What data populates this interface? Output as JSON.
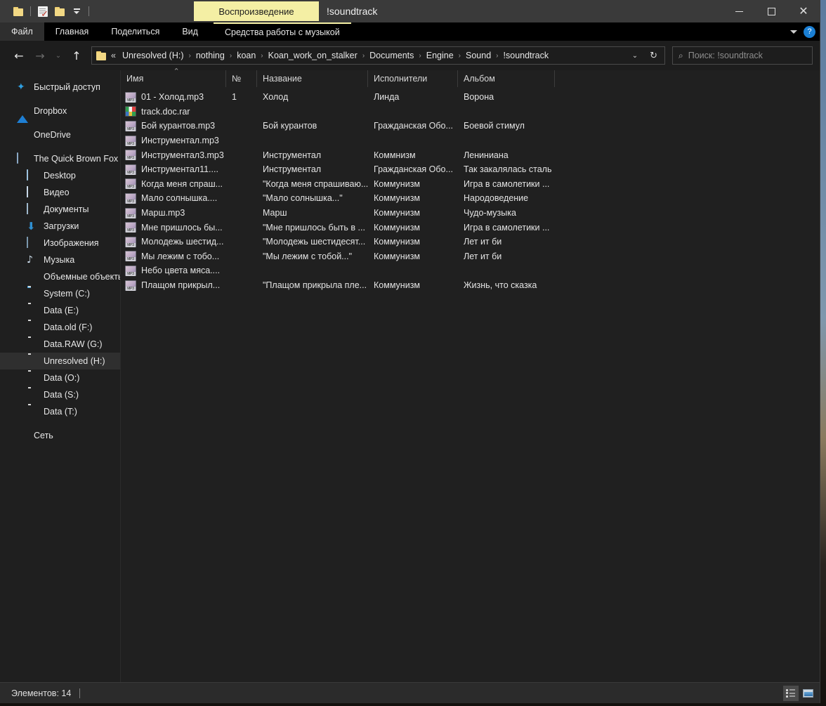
{
  "titlebar": {
    "quick_access": [
      {
        "name": "new-folder-icon",
        "label": "Новая папка"
      },
      {
        "name": "properties-icon",
        "label": "Свойства"
      },
      {
        "name": "folder-icon",
        "label": "Папка"
      },
      {
        "name": "customize-chevron-icon",
        "label": "Настройка панели быстрого доступа"
      }
    ],
    "contextual_tab_highlight": "Воспроизведение",
    "window_title": "!soundtrack",
    "minimize_label": "Свернуть",
    "maximize_label": "Развернуть",
    "close_label": "Закрыть",
    "highlight_color": "#f4efa4"
  },
  "ribbon": {
    "tabs": [
      {
        "label": "Файл",
        "selected": true
      },
      {
        "label": "Главная",
        "selected": false
      },
      {
        "label": "Поделиться",
        "selected": false
      },
      {
        "label": "Вид",
        "selected": false
      }
    ],
    "contextual_tab": "Средства работы с музыкой",
    "expand_label": "Развернуть ленту",
    "help_label": "?"
  },
  "address": {
    "back_label": "Назад",
    "forward_label": "Вперед",
    "recent_label": "Последние расположения",
    "up_label": "Вверх",
    "overflow": "«",
    "crumbs": [
      "Unresolved (H:)",
      "nothing",
      "koan",
      "Koan_work_on_stalker",
      "Documents",
      "Engine",
      "Sound",
      "!soundtrack"
    ],
    "dropdown_label": "Предыдущие расположения",
    "refresh_label": "Обновить"
  },
  "search": {
    "placeholder": "Поиск: !soundtrack",
    "value": ""
  },
  "sidebar": {
    "items": [
      {
        "label": "Быстрый доступ",
        "icon": "star-icon",
        "indent": false,
        "selected": false
      },
      {
        "label": "Dropbox",
        "icon": "dropbox-icon",
        "indent": false,
        "selected": false
      },
      {
        "label": "OneDrive",
        "icon": "cloud-icon",
        "indent": false,
        "selected": false
      },
      {
        "label": "The Quick Brown Fox",
        "icon": "computer-icon",
        "indent": false,
        "selected": false
      },
      {
        "label": "Desktop",
        "icon": "desktop-icon",
        "indent": true,
        "selected": false
      },
      {
        "label": "Видео",
        "icon": "video-icon",
        "indent": true,
        "selected": false
      },
      {
        "label": "Документы",
        "icon": "documents-icon",
        "indent": true,
        "selected": false
      },
      {
        "label": "Загрузки",
        "icon": "downloads-icon",
        "indent": true,
        "selected": false
      },
      {
        "label": "Изображения",
        "icon": "pictures-icon",
        "indent": true,
        "selected": false
      },
      {
        "label": "Музыка",
        "icon": "music-icon",
        "indent": true,
        "selected": false
      },
      {
        "label": "Объемные объекты",
        "icon": "3d-objects-icon",
        "indent": true,
        "selected": false
      },
      {
        "label": "System (C:)",
        "icon": "system-drive-icon",
        "indent": true,
        "selected": false
      },
      {
        "label": "Data (E:)",
        "icon": "drive-icon",
        "indent": true,
        "selected": false
      },
      {
        "label": "Data.old (F:)",
        "icon": "drive-icon",
        "indent": true,
        "selected": false
      },
      {
        "label": "Data.RAW (G:)",
        "icon": "drive-icon",
        "indent": true,
        "selected": false
      },
      {
        "label": "Unresolved (H:)",
        "icon": "drive-icon",
        "indent": true,
        "selected": true
      },
      {
        "label": "Data (O:)",
        "icon": "drive-icon",
        "indent": true,
        "selected": false
      },
      {
        "label": "Data (S:)",
        "icon": "drive-icon",
        "indent": true,
        "selected": false
      },
      {
        "label": "Data (T:)",
        "icon": "drive-icon",
        "indent": true,
        "selected": false
      }
    ],
    "network": {
      "label": "Сеть",
      "icon": "network-icon"
    }
  },
  "filelist": {
    "columns": [
      {
        "label": "Имя",
        "sorted": true
      },
      {
        "label": "№",
        "sorted": false
      },
      {
        "label": "Название",
        "sorted": false
      },
      {
        "label": "Исполнители",
        "sorted": false
      },
      {
        "label": "Альбом",
        "sorted": false
      }
    ],
    "rows": [
      {
        "icon": "mp3-file-icon",
        "name": "01 - Холод.mp3",
        "num": "1",
        "title": "Холод",
        "artist": "Линда",
        "album": "Ворона"
      },
      {
        "icon": "rar-archive-icon",
        "name": "track.doc.rar",
        "num": "",
        "title": "",
        "artist": "",
        "album": ""
      },
      {
        "icon": "mp3-file-icon",
        "name": "Бой курантов.mp3",
        "num": "",
        "title": "Бой курантов",
        "artist": "Гражданская Обо...",
        "album": "Боевой стимул"
      },
      {
        "icon": "mp3-file-icon",
        "name": "Инструментал.mp3",
        "num": "",
        "title": "",
        "artist": "",
        "album": ""
      },
      {
        "icon": "mp3-file-icon",
        "name": "Инструментал3.mp3",
        "num": "",
        "title": "Инструментал",
        "artist": "Коммнизм",
        "album": "Лениниана"
      },
      {
        "icon": "mp3-file-icon",
        "name": "Инструментал11....",
        "num": "",
        "title": "Инструментал",
        "artist": "Гражданская Обо...",
        "album": "Так закалялась сталь"
      },
      {
        "icon": "mp3-file-icon",
        "name": "Когда меня спраш...",
        "num": "",
        "title": "\"Когда меня спрашиваю...",
        "artist": "Коммунизм",
        "album": "Игра в самолетики ..."
      },
      {
        "icon": "mp3-file-icon",
        "name": "Мало солнышка....",
        "num": "",
        "title": "\"Мало солнышка...\"",
        "artist": "Коммунизм",
        "album": "Народоведение"
      },
      {
        "icon": "mp3-file-icon",
        "name": "Марш.mp3",
        "num": "",
        "title": "Марш",
        "artist": "Коммунизм",
        "album": "Чудо-музыка"
      },
      {
        "icon": "mp3-file-icon",
        "name": "Мне пришлось бы...",
        "num": "",
        "title": "\"Мне пришлось быть в ...",
        "artist": "Коммунизм",
        "album": "Игра в самолетики ..."
      },
      {
        "icon": "mp3-file-icon",
        "name": "Молодежь шестид...",
        "num": "",
        "title": "\"Молодежь шестидесят...",
        "artist": "Коммунизм",
        "album": "Лет ит би"
      },
      {
        "icon": "mp3-file-icon",
        "name": "Мы лежим с тобо...",
        "num": "",
        "title": "\"Мы лежим с тобой...\"",
        "artist": "Коммунизм",
        "album": "Лет ит би"
      },
      {
        "icon": "mp3-file-icon",
        "name": "Небо цвета мяса....",
        "num": "",
        "title": "",
        "artist": "",
        "album": ""
      },
      {
        "icon": "mp3-file-icon",
        "name": "Плащом прикрыл...",
        "num": "",
        "title": "\"Плащом прикрыла пле...",
        "artist": "Коммунизм",
        "album": "Жизнь, что сказка"
      }
    ]
  },
  "statusbar": {
    "item_count_text": "Элементов: 14",
    "details_view_label": "Таблица",
    "large_icons_view_label": "Крупные значки"
  }
}
